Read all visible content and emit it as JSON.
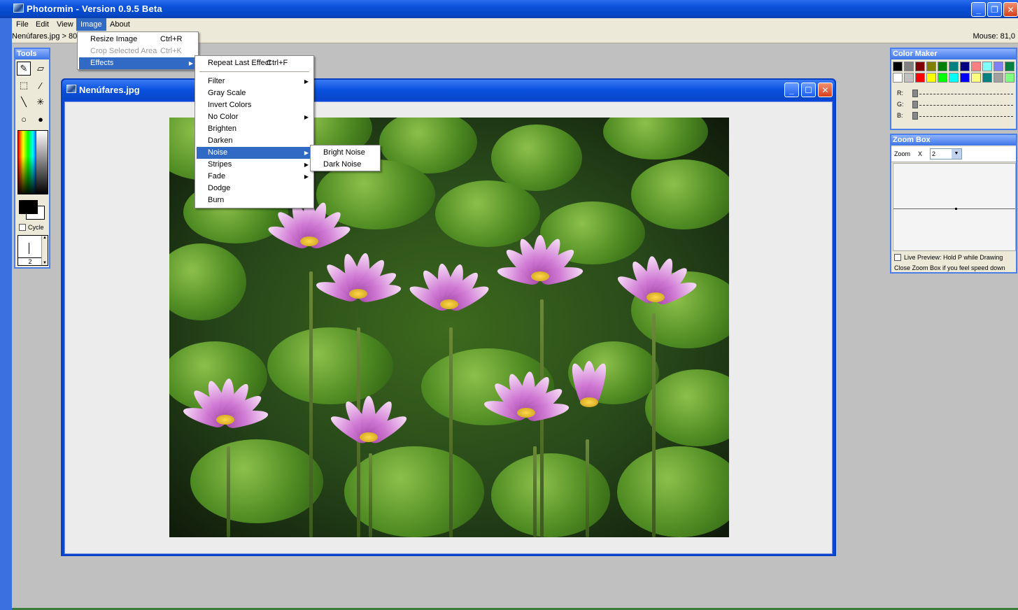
{
  "app": {
    "title": "Photormin - Version 0.9.5 Beta"
  },
  "menubar": {
    "items": [
      "File",
      "Edit",
      "View",
      "Image",
      "About"
    ]
  },
  "status": {
    "path": "Nenúfares.jpg > 80",
    "mouse": "Mouse: 81,0"
  },
  "tools": {
    "title": "Tools",
    "cycle_label": "Cycle",
    "brush_size": "2"
  },
  "image_window": {
    "title": "Nenúfares.jpg"
  },
  "image_menu": {
    "resize": {
      "label": "Resize Image",
      "shortcut": "Ctrl+R"
    },
    "crop": {
      "label": "Crop Selected Area",
      "shortcut": "Ctrl+K"
    },
    "effects": {
      "label": "Effects"
    }
  },
  "effects_menu": {
    "repeat": {
      "label": "Repeat Last Effect",
      "shortcut": "Ctrl+F"
    },
    "items": [
      "Filter",
      "Gray Scale",
      "Invert Colors",
      "No Color",
      "Brighten",
      "Darken",
      "Noise",
      "Stripes",
      "Fade",
      "Dodge",
      "Burn"
    ]
  },
  "noise_menu": {
    "items": [
      "Bright Noise",
      "Dark Noise"
    ]
  },
  "color_maker": {
    "title": "Color Maker",
    "palette": [
      "#000000",
      "#808080",
      "#800000",
      "#808000",
      "#008000",
      "#008080",
      "#000080",
      "#ff8080",
      "#80ffff",
      "#8080ff",
      "#008040",
      "#ffffff",
      "#c0c0c0",
      "#ff0000",
      "#ffff00",
      "#00ff00",
      "#00ffff",
      "#0000ff",
      "#ffff80",
      "#008080",
      "#a0a0a0",
      "#80ff80"
    ],
    "r_label": "R:",
    "g_label": "G:",
    "b_label": "B:"
  },
  "zoom_box": {
    "title": "Zoom Box",
    "zoom_label": "Zoom",
    "x_label": "X",
    "zoom_value": "2",
    "live_preview": "Live Preview: Hold P while Drawing",
    "note": "Close Zoom Box if you feel speed down"
  }
}
